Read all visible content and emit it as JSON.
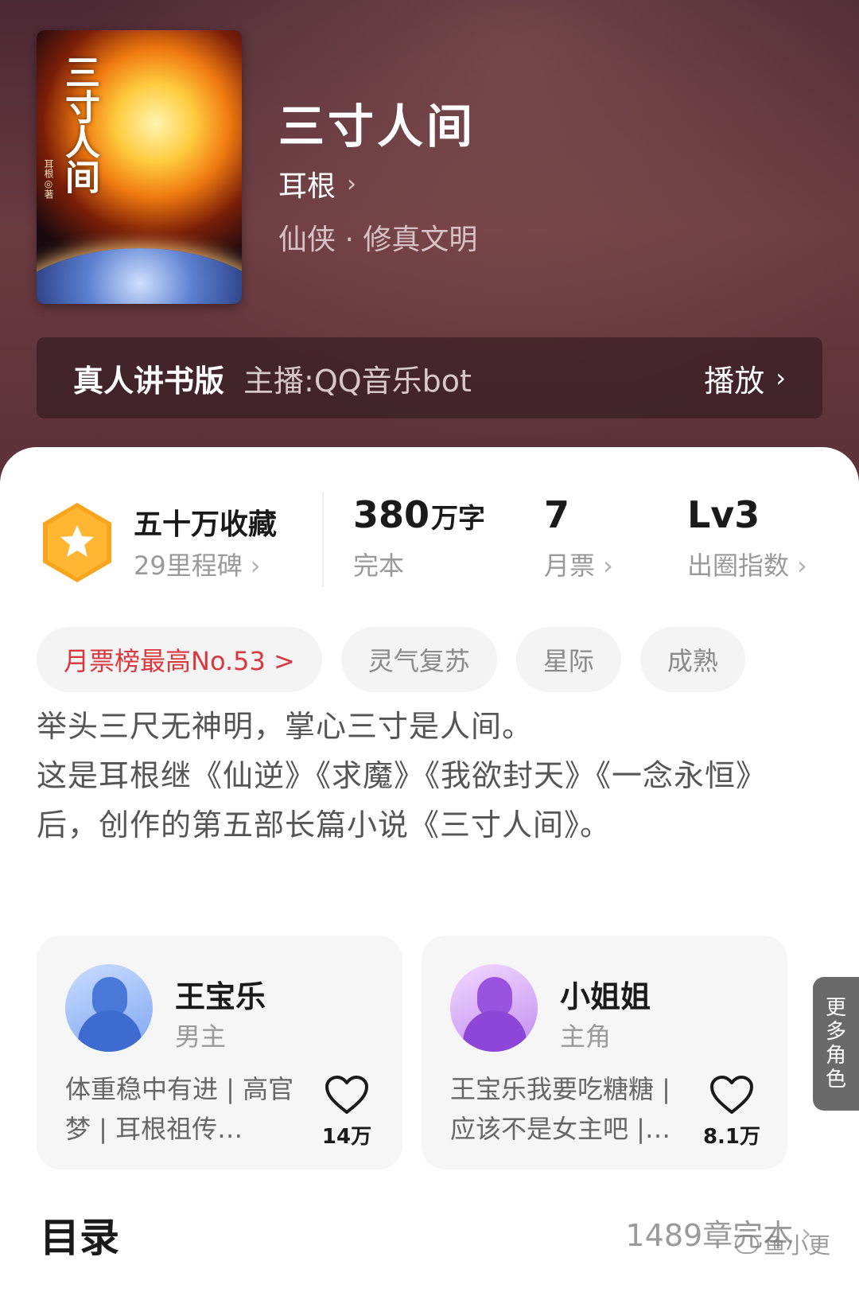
{
  "book": {
    "cover_title": "三寸人间",
    "cover_author": "耳根◎著",
    "title": "三寸人间",
    "author": "耳根",
    "author_chevron": "›",
    "genre": "仙侠 · 修真文明"
  },
  "audio": {
    "title": "真人讲书版",
    "host": "主播:QQ音乐bot",
    "play_label": "播放",
    "chevron": "›"
  },
  "stats": {
    "collect_title": "五十万收藏",
    "collect_sub": "29里程碑",
    "words_value": "380",
    "words_unit": "万字",
    "words_sub": "完本",
    "tickets_value": "7",
    "tickets_sub": "月票",
    "level_value": "Lv3",
    "level_sub": "出圈指数",
    "chevron": "›"
  },
  "tags": [
    "月票榜最高No.53 >",
    "灵气复苏",
    "星际",
    "成熟"
  ],
  "intro": {
    "line1": "举头三尺无神明，掌心三寸是人间。",
    "line2": "这是耳根继《仙逆》《求魔》《我欲封天》《一念永恒》后，创作的第五部长篇小说《三寸人间》。"
  },
  "roles": [
    {
      "name": "王宝乐",
      "type": "男主",
      "desc": "体重稳中有进 | 高官梦 | 耳根祖传…",
      "likes": "14万"
    },
    {
      "name": "小姐姐",
      "type": "主角",
      "desc": "王宝乐我要吃糖糖 | 应该不是女主吧 |…",
      "likes": "8.1万"
    }
  ],
  "more_roles": "更多角色",
  "toc": {
    "title": "目录",
    "count": "1489章完本",
    "chevron": "›"
  },
  "watermark": "鱼小更",
  "colors": {
    "hot_tag": "#d9383e",
    "medal": "#f7a51c",
    "hero_bg": "#5a3038"
  }
}
